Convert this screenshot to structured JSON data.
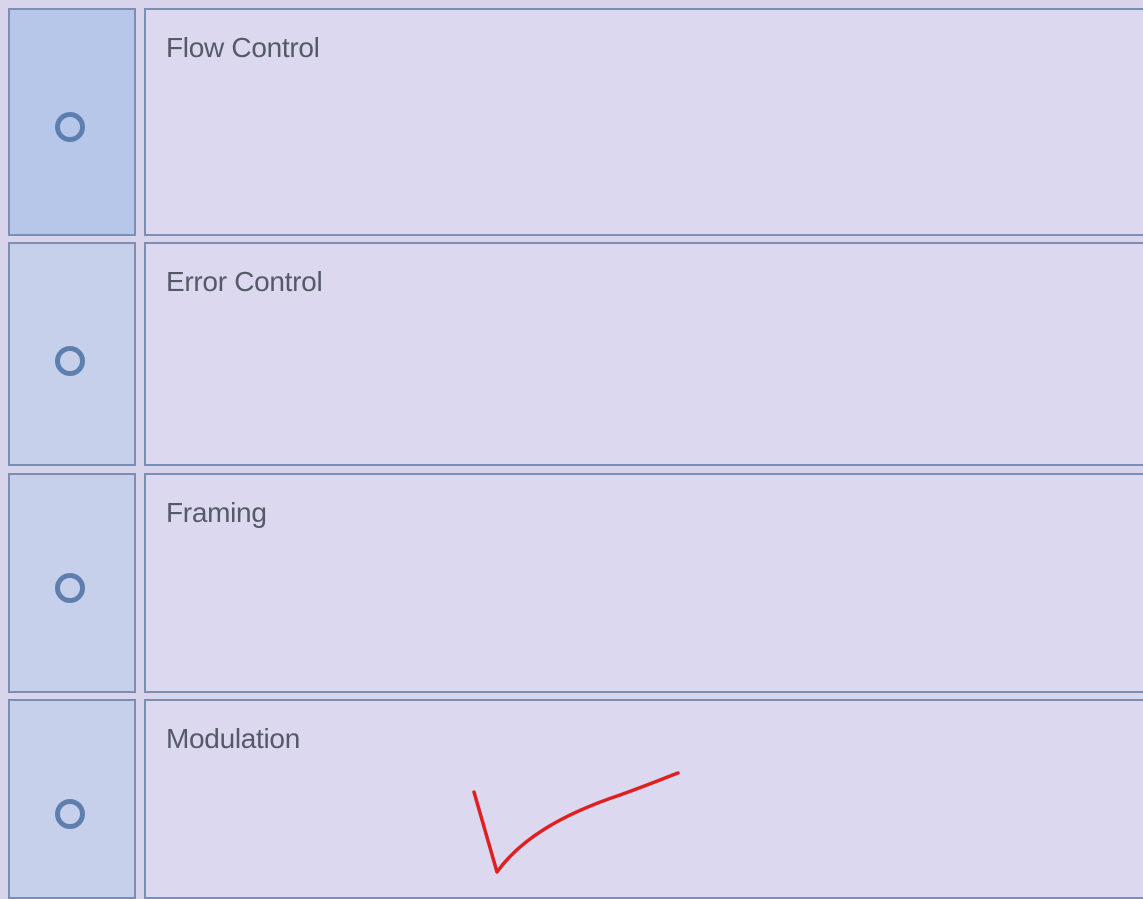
{
  "options": [
    {
      "label": "Flow Control",
      "selected": false
    },
    {
      "label": "Error Control",
      "selected": false
    },
    {
      "label": "Framing",
      "selected": false
    },
    {
      "label": "Modulation",
      "selected": false
    }
  ],
  "colors": {
    "background": "#dcd8f0",
    "radio_cell": "#c6d0ea",
    "border": "#7c8fb3",
    "radio_ring": "#5e7fae",
    "label_text": "#545a66",
    "annotation": "#e02020"
  },
  "annotation": {
    "icon": "check-mark-icon",
    "marks_option": "Modulation"
  }
}
